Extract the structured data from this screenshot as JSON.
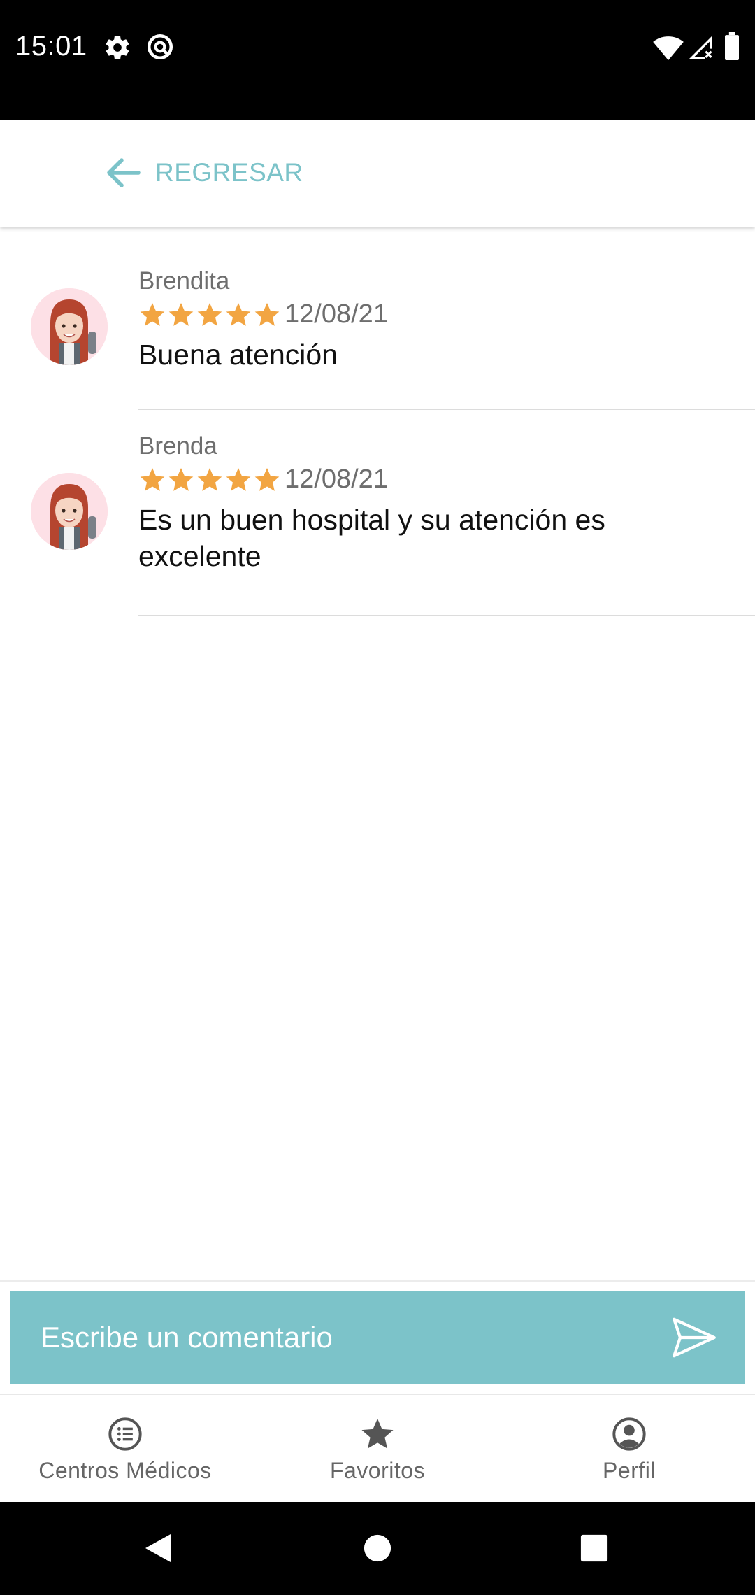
{
  "status_bar": {
    "time": "15:01"
  },
  "top_bar": {
    "back_label": "REGRESAR"
  },
  "colors": {
    "accent": "#7cc3c9",
    "star": "#f2a542",
    "avatar_bg": "#fde0e6"
  },
  "comments": [
    {
      "name": "Brendita",
      "rating": 5,
      "date": "12/08/21",
      "text": "Buena atención"
    },
    {
      "name": "Brenda",
      "rating": 5,
      "date": "12/08/21",
      "text": "Es un buen hospital y su atención es excelente"
    }
  ],
  "comment_input": {
    "placeholder": "Escribe un comentario"
  },
  "bottom_nav": {
    "items": [
      {
        "label": "Centros Médicos",
        "icon": "list-circle-icon"
      },
      {
        "label": "Favoritos",
        "icon": "star-icon"
      },
      {
        "label": "Perfil",
        "icon": "account-circle-icon"
      }
    ]
  }
}
